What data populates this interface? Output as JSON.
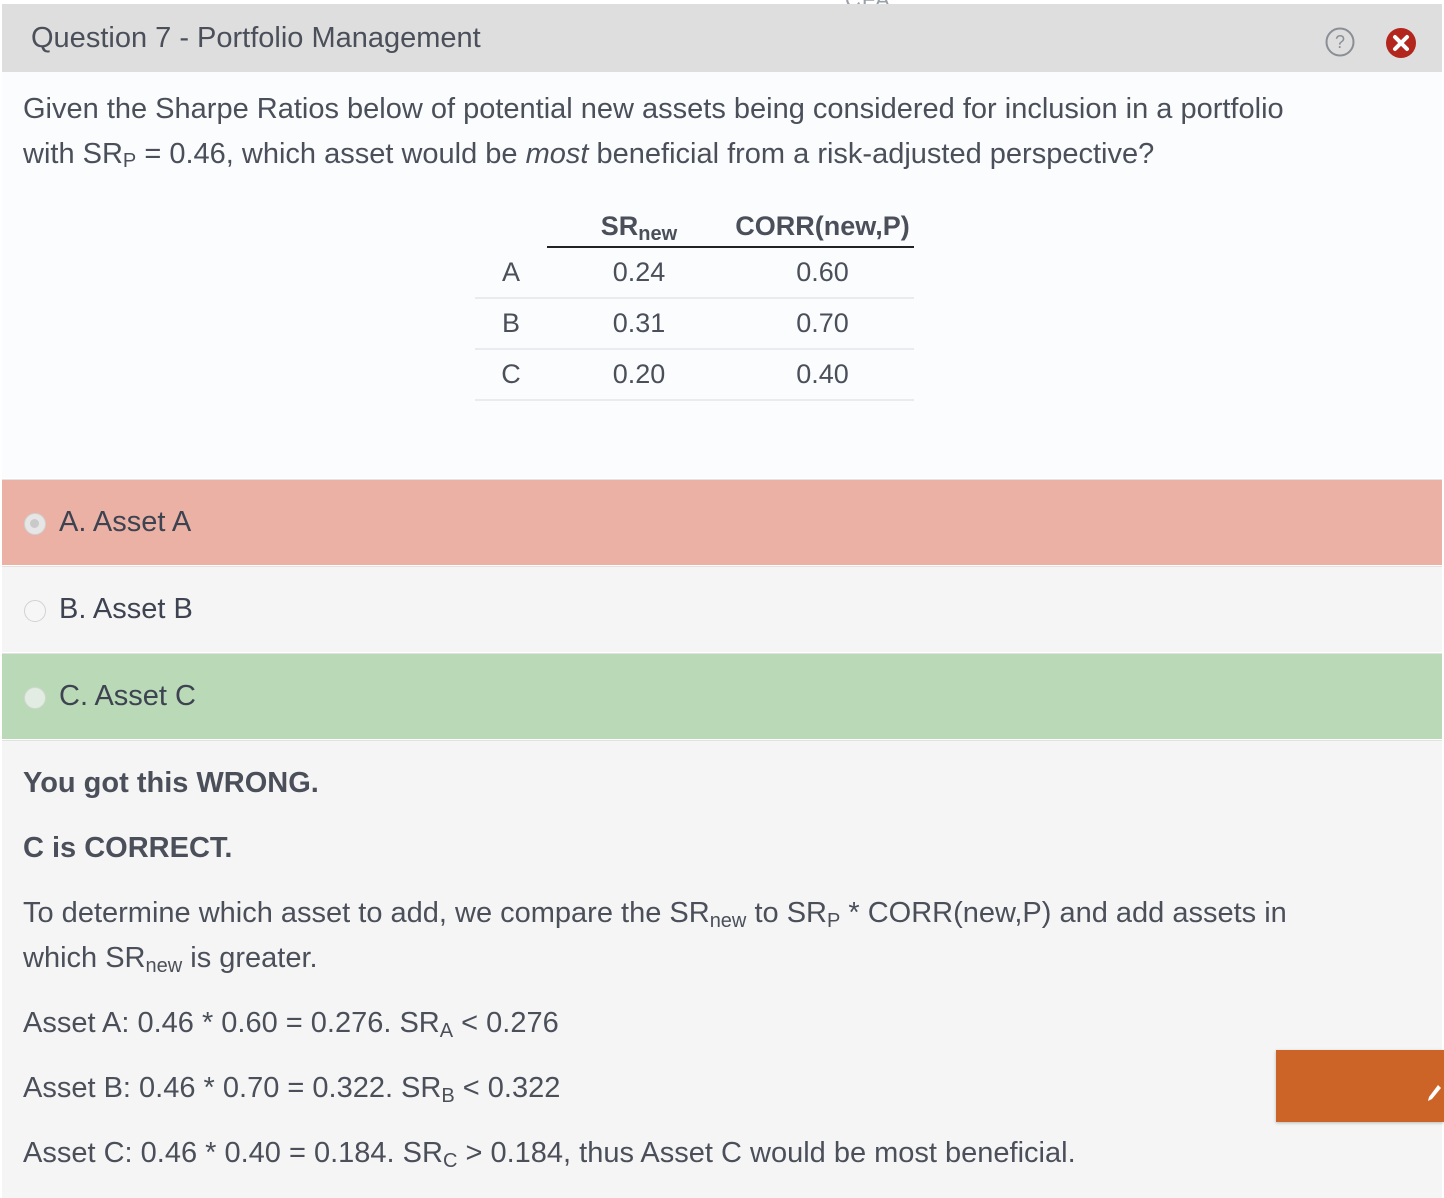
{
  "top_label": "CFA",
  "header": {
    "title": "Question 7 - Portfolio Management"
  },
  "question": {
    "line1": "Given the Sharpe Ratios below of potential new assets being considered for inclusion in a portfolio",
    "line2_pre": "with SR",
    "line2_sub": "P",
    "line2_mid": " = 0.46, which asset would be ",
    "line2_em": "most",
    "line2_post": " beneficial from a risk-adjusted perspective?"
  },
  "table": {
    "headers": {
      "sr": "SR",
      "sr_sub": "new",
      "corr": "CORR(new,P)"
    },
    "rows": [
      {
        "asset": "A",
        "sr": "0.24",
        "corr": "0.60"
      },
      {
        "asset": "B",
        "sr": "0.31",
        "corr": "0.70"
      },
      {
        "asset": "C",
        "sr": "0.20",
        "corr": "0.40"
      }
    ]
  },
  "options": [
    {
      "label": "A. Asset A",
      "state": "selected-wrong",
      "color": "#ebb1a5"
    },
    {
      "label": "B. Asset B",
      "state": "unselected",
      "color": "#f5f5f5"
    },
    {
      "label": "C. Asset C",
      "state": "correct",
      "color": "#b9d9b7"
    }
  ],
  "explanation": {
    "result": "You got this WRONG.",
    "correct": "C is CORRECT.",
    "body1_a": "To determine which asset to add, we compare the SR",
    "body1_sub1": "new",
    "body1_b": " to SR",
    "body1_sub2": "P",
    "body1_c": " * CORR(new,P) and add assets in",
    "body2_a": "which SR",
    "body2_sub": "new",
    "body2_b": " is greater.",
    "lines": [
      {
        "pre": "Asset A: 0.46 * 0.60 = 0.276.  SR",
        "sub": "A",
        "post": " < 0.276"
      },
      {
        "pre": "Asset B: 0.46 * 0.70 = 0.322.  SR",
        "sub": "B",
        "post": " < 0.322"
      },
      {
        "pre": "Asset C: 0.46 * 0.40 = 0.184.  SR",
        "sub": "C",
        "post": " > 0.184, thus Asset C would be most beneficial."
      }
    ]
  },
  "colors": {
    "accent": "#cc6428",
    "close": "#b3261e",
    "header_bg": "#dedede"
  },
  "icons": {
    "help": "help-icon",
    "close": "close-icon",
    "pencil": "pencil-icon"
  }
}
